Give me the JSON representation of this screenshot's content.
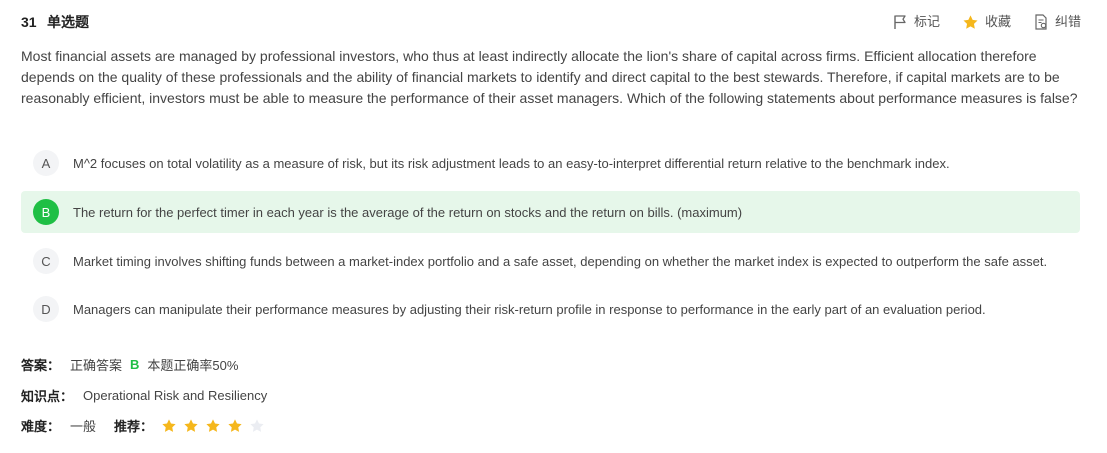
{
  "header": {
    "number": "31",
    "type": "单选题",
    "actions": {
      "mark": "标记",
      "favorite": "收藏",
      "report": "纠错"
    }
  },
  "question": "Most financial assets are managed by professional investors, who thus at least indirectly allocate the lion's share of capital across firms. Efficient allocation therefore depends on the quality of these professionals and the ability of financial markets to identify and direct capital to the best stewards. Therefore, if capital markets are to be reasonably efficient, investors must be able to measure the performance of their asset managers. Which of the following statements about performance measures is false?",
  "options": [
    {
      "letter": "A",
      "text": "M^2 focuses on total volatility as a measure of risk, but its risk adjustment leads to an easy-to-interpret differential return relative to the benchmark index."
    },
    {
      "letter": "B",
      "text": "The return for the perfect timer in each year is the average of the return on stocks and the return on bills. (maximum)"
    },
    {
      "letter": "C",
      "text": "Market timing involves shifting funds between a market-index portfolio and a safe asset, depending on whether the market index is expected to outperform the safe asset."
    },
    {
      "letter": "D",
      "text": "Managers can manipulate their performance measures by adjusting their risk-return profile in response to performance in the early part of an evaluation period."
    }
  ],
  "answer": {
    "label": "答案：",
    "prefix": "正确答案",
    "correct": "B",
    "rate_text": "本题正确率50%"
  },
  "knowledge": {
    "label": "知识点：",
    "value": "Operational Risk and Resiliency"
  },
  "difficulty": {
    "label": "难度：",
    "value": "一般"
  },
  "recommend": {
    "label": "推荐：",
    "rating": 4,
    "max": 5
  },
  "colors": {
    "accent_green": "#1fbf45",
    "correct_bg": "#e6f7ea",
    "star_on": "#f5b71c",
    "star_off": "#ebedf2"
  }
}
